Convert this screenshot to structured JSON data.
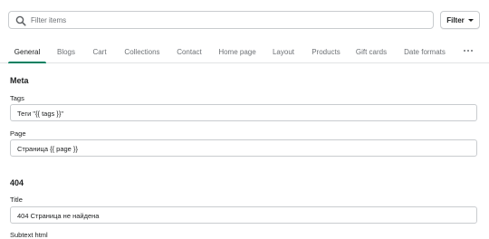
{
  "search": {
    "placeholder": "Filter items",
    "value": ""
  },
  "filter_button": {
    "label": "Filter"
  },
  "tabs": [
    {
      "label": "General",
      "active": true
    },
    {
      "label": "Blogs"
    },
    {
      "label": "Cart"
    },
    {
      "label": "Collections"
    },
    {
      "label": "Contact"
    },
    {
      "label": "Home page"
    },
    {
      "label": "Layout"
    },
    {
      "label": "Products"
    },
    {
      "label": "Gift cards"
    },
    {
      "label": "Date formats"
    }
  ],
  "sections": {
    "meta": {
      "title": "Meta",
      "fields": [
        {
          "label": "Tags",
          "value": "Теги \"{{ tags }}\""
        },
        {
          "label": "Page",
          "value": "Страница {{ page }}"
        }
      ]
    },
    "not_found": {
      "title": "404",
      "fields": [
        {
          "label": "Title",
          "value": "404 Страница не найдена"
        },
        {
          "label": "Subtext html"
        }
      ]
    }
  },
  "colors": {
    "accent": "#008060",
    "border": "#c9cccf",
    "muted_text": "#6d7175"
  }
}
